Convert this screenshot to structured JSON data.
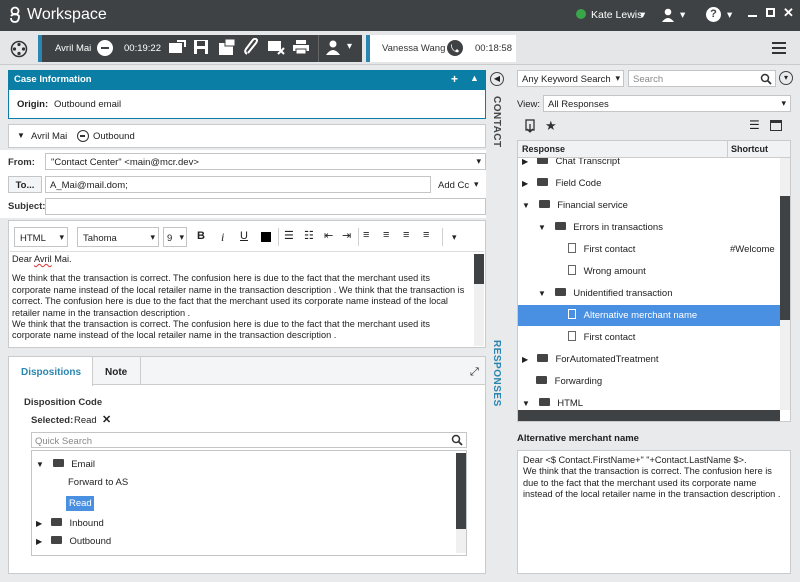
{
  "titlebar": {
    "app_title": "Workspace",
    "user_name": "Kate Lewis"
  },
  "calls": {
    "active": {
      "name": "Avril Mai",
      "timer": "00:19:22"
    },
    "other": {
      "name": "Vanessa Wang",
      "timer": "00:18:58"
    }
  },
  "case": {
    "header": "Case Information",
    "header_add": "+",
    "origin_label": "Origin:",
    "origin_value": "Outbound email",
    "contact_name": "Avril Mai",
    "direction": "Outbound"
  },
  "email": {
    "from_label": "From:",
    "from_value": "\"Contact Center\" <main@mcr.dev>",
    "to_button": "To...",
    "to_value": "A_Mai@mail.dom;",
    "add_cc": "Add Cc",
    "subject_label": "Subject:",
    "subject_value": "",
    "format": "HTML",
    "font": "Tahoma",
    "size": "9",
    "body_greeting_prefix": "Dear ",
    "body_greeting_name": "Avril",
    "body_greeting_suffix": " Mai.",
    "body_p1": "We think that the transaction is correct. The confusion here is due to the fact that the merchant used its corporate name instead of the local retailer name in the transaction description . We think that the transaction is correct. The confusion here is due to the fact that the merchant used its corporate name instead of the local retailer name in the transaction description .",
    "body_p2": "We think that the transaction is correct. The confusion here is due to the fact that the merchant used its corporate name instead of the local retailer name in the transaction description ."
  },
  "dispositions": {
    "tabs": [
      "Dispositions",
      "Note"
    ],
    "code_title": "Disposition Code",
    "selected_label": "Selected:",
    "selected_value": "Read",
    "search_placeholder": "Quick Search",
    "tree": {
      "email": "Email",
      "forward": "Forward to AS",
      "read": "Read",
      "inbound": "Inbound",
      "outbound": "Outbound"
    }
  },
  "sidetabs": {
    "contact": "CONTACT",
    "responses": "RESPONSES"
  },
  "responses": {
    "search_mode": "Any Keyword Search",
    "search_placeholder": "Search",
    "view_label": "View:",
    "view_value": "All Responses",
    "col_response": "Response",
    "col_shortcut": "Shortcut",
    "items": {
      "chat": "Chat Transcript",
      "fieldcode": "Field Code",
      "financial": "Financial service",
      "errors": "Errors in transactions",
      "first_contact": "First contact",
      "welcome": "#Welcome",
      "wrong_amount": "Wrong amount",
      "unidentified": "Unidentified transaction",
      "alt_merchant": "Alternative merchant name",
      "first_contact2": "First contact",
      "automated": "ForAutomatedTreatment",
      "forwarding": "Forwarding",
      "html": "HTML"
    },
    "preview_title": "Alternative merchant name",
    "preview_line1": "Dear <$ Contact.FirstName+\" \"+Contact.LastName $>.",
    "preview_line2": "We think that the transaction is correct. The confusion here is due to the fact that the merchant used its corporate name instead of the local retailer name in the transaction description ."
  },
  "colors": {
    "accent": "#0b7ea6",
    "dark": "#3f4245",
    "selected": "#4a90e2",
    "phone_green": "#3aa64a"
  }
}
